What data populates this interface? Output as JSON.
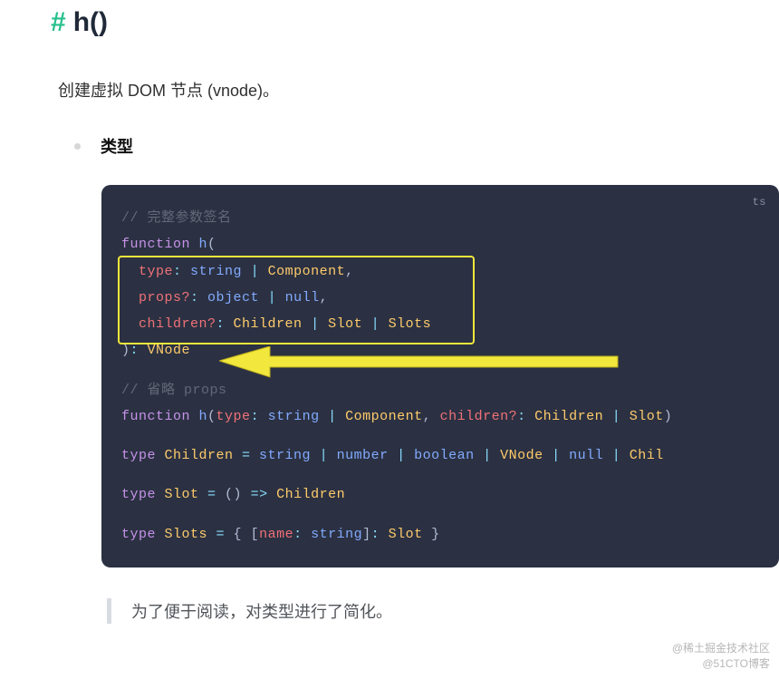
{
  "header": {
    "hash": "#",
    "title": "h()"
  },
  "description": "创建虚拟 DOM 节点 (vnode)。",
  "bullet_label": "类型",
  "lang_tag": "ts",
  "code": {
    "c1": "// 完整参数签名",
    "l2_kw": "function",
    "l2_fn": " h",
    "l2_paren": "(",
    "l3_pad": "  ",
    "l3_param": "type",
    "l3_op1": ": ",
    "l3_t1": "string",
    "l3_op2": " | ",
    "l3_t2": "Component",
    "l3_comma": ",",
    "l4_pad": "  ",
    "l4_param": "props?",
    "l4_op1": ": ",
    "l4_t1": "object",
    "l4_op2": " | ",
    "l4_t2": "null",
    "l4_comma": ",",
    "l5_pad": "  ",
    "l5_param": "children?",
    "l5_op1": ": ",
    "l5_t1": "Children",
    "l5_op2": " | ",
    "l5_t2": "Slot",
    "l5_op3": " | ",
    "l5_t3": "Slots",
    "l6_close": ")",
    "l6_op": ": ",
    "l6_ret": "VNode",
    "c2": "// 省略 props",
    "l8_kw": "function",
    "l8_fn": " h",
    "l8_paren": "(",
    "l8_param1": "type",
    "l8_op1": ": ",
    "l8_t1": "string",
    "l8_op2": " | ",
    "l8_t2": "Component",
    "l8_comma": ", ",
    "l8_param2": "children?",
    "l8_op3": ": ",
    "l8_t3": "Children",
    "l8_op4": " | ",
    "l8_t4": "Slot",
    "l8_close": ")",
    "l10_kw": "type",
    "l10_name": " Children ",
    "l10_eq": "= ",
    "l10_t1": "string",
    "l10_op1": " | ",
    "l10_t2": "number",
    "l10_op2": " | ",
    "l10_t3": "boolean",
    "l10_op3": " | ",
    "l10_t4": "VNode",
    "l10_op4": " | ",
    "l10_t5": "null",
    "l10_op5": " | ",
    "l10_t6": "Chil",
    "l12_kw": "type",
    "l12_name": " Slot ",
    "l12_eq": "= ",
    "l12_paren": "()",
    "l12_arrow": " => ",
    "l12_ret": "Children",
    "l14_kw": "type",
    "l14_name": " Slots ",
    "l14_eq": "= ",
    "l14_open": "{ ",
    "l14_br": "[",
    "l14_iname": "name",
    "l14_op1": ": ",
    "l14_itype": "string",
    "l14_br2": "]",
    "l14_op2": ": ",
    "l14_vtype": "Slot",
    "l14_close": " }"
  },
  "note": "为了便于阅读，对类型进行了简化。",
  "watermark": {
    "line1": "@稀土掘金技术社区",
    "line2": "@51CTO博客"
  }
}
